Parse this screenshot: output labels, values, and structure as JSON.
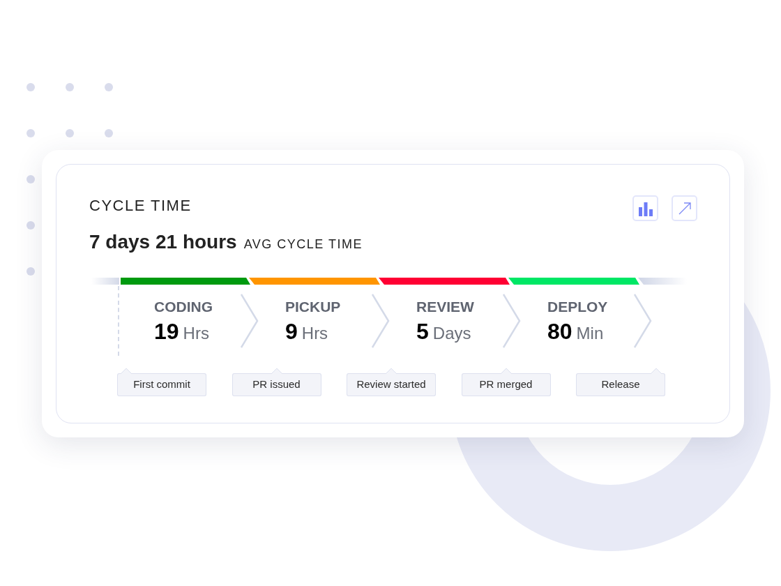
{
  "card": {
    "title": "CYCLE TIME",
    "average": "7 days 21 hours",
    "average_label": "AVG CYCLE TIME"
  },
  "stages": [
    {
      "name": "CODING",
      "value": "19",
      "unit": "Hrs",
      "color": "#009a0f"
    },
    {
      "name": "PICKUP",
      "value": "9",
      "unit": "Hrs",
      "color": "#ff9500"
    },
    {
      "name": "REVIEW",
      "value": "5",
      "unit": "Days",
      "color": "#ff0033"
    },
    {
      "name": "DEPLOY",
      "value": "80",
      "unit": "Min",
      "color": "#00e765"
    }
  ],
  "milestones": [
    "First commit",
    "PR issued",
    "Review started",
    "PR merged",
    "Release"
  ]
}
